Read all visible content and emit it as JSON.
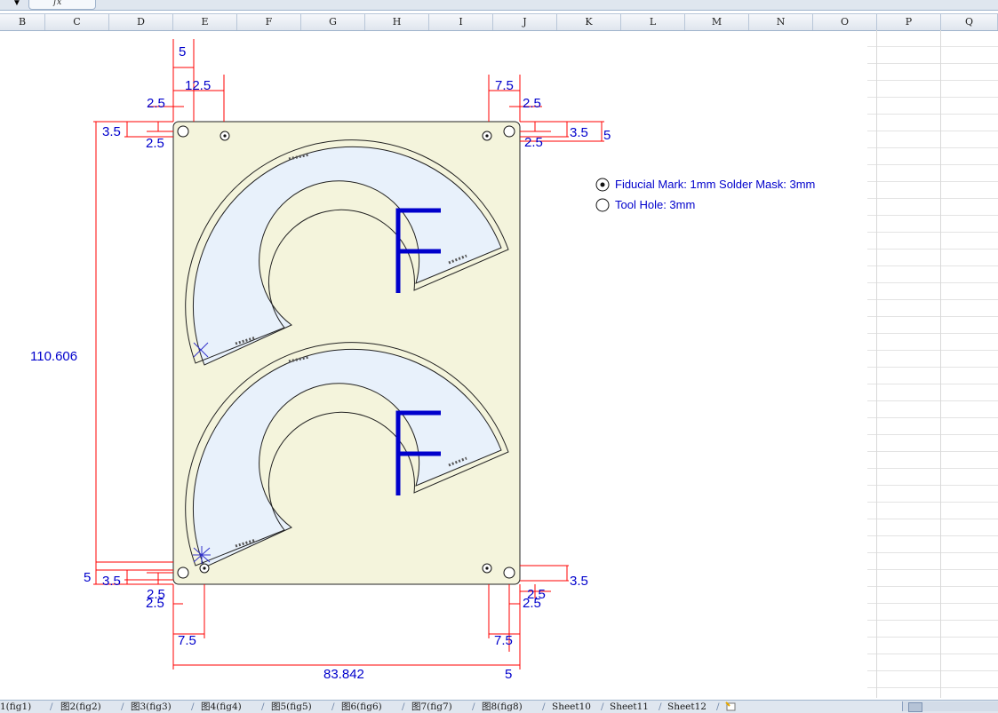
{
  "formula_bar": {
    "name_box_arrow": "▼",
    "fx_label": "fx"
  },
  "columns": [
    "B",
    "C",
    "D",
    "E",
    "F",
    "G",
    "H",
    "I",
    "J",
    "K",
    "L",
    "M",
    "N",
    "O",
    "P",
    "Q"
  ],
  "drawing": {
    "dims": {
      "top_5": "5",
      "top_12_5": "12.5",
      "top_left_2_5": "2.5",
      "left_3_5_top": "3.5",
      "left_2_5_top": "2.5",
      "top_right_7_5": "7.5",
      "top_right_2_5": "2.5",
      "right_3_5_top": "3.5",
      "right_5_top": "5",
      "right_2_5_top": "2.5",
      "height_total": "110.606",
      "bottom_left_5": "5",
      "bottom_left_3_5": "3.5",
      "bottom_left_2_5_a": "2.5",
      "bottom_left_2_5_b": "2.5",
      "bottom_7_5_left": "7.5",
      "bottom_7_5_right": "7.5",
      "bottom_right_2_5_a": "2.5",
      "bottom_right_2_5_b": "2.5",
      "bottom_right_3_5": "3.5",
      "width_total": "83.842",
      "bottom_5": "5"
    },
    "panel_letters": [
      "F",
      "F"
    ],
    "legend": {
      "fiducial": "Fiducial Mark: 1mm  Solder Mask: 3mm",
      "tool_hole": "Tool Hole: 3mm"
    },
    "colors": {
      "dimension": "#ff0000",
      "text": "#0000cc",
      "panel": "#f4f4dc",
      "part": "#e8f1fb"
    }
  },
  "sheet_tabs": [
    "1(fig1)",
    "图2(fig2)",
    "图3(fig3)",
    "图4(fig4)",
    "图5(fig5)",
    "图6(fig6)",
    "图7(fig7)",
    "图8(fig8)",
    "Sheet10",
    "Sheet11",
    "Sheet12"
  ]
}
